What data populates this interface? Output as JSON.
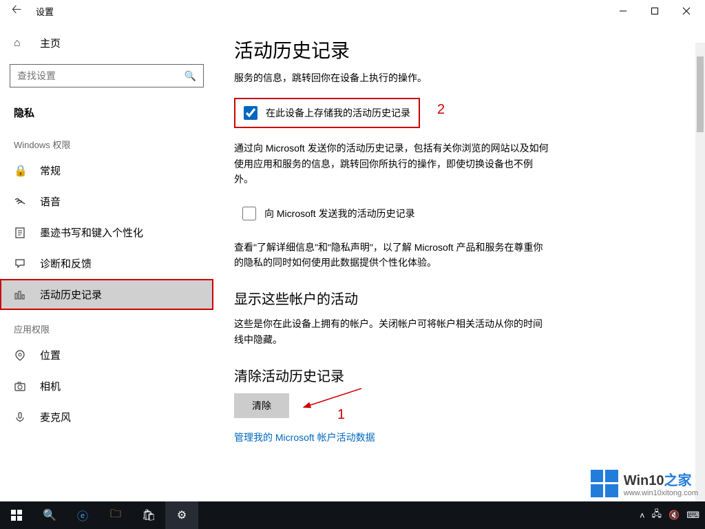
{
  "window": {
    "title": "设置"
  },
  "sidebar": {
    "home": "主页",
    "search_placeholder": "查找设置",
    "section": "隐私",
    "groups": [
      {
        "title": "Windows 权限",
        "items": [
          {
            "icon": "lock-icon",
            "label": "常规"
          },
          {
            "icon": "speech-icon",
            "label": "语音"
          },
          {
            "icon": "ink-icon",
            "label": "墨迹书写和键入个性化"
          },
          {
            "icon": "feedback-icon",
            "label": "诊断和反馈"
          },
          {
            "icon": "history-icon",
            "label": "活动历史记录",
            "selected": true,
            "highlight": true
          }
        ]
      },
      {
        "title": "应用权限",
        "items": [
          {
            "icon": "location-icon",
            "label": "位置"
          },
          {
            "icon": "camera-icon",
            "label": "相机"
          },
          {
            "icon": "mic-icon",
            "label": "麦克风"
          }
        ]
      }
    ]
  },
  "main": {
    "heading": "活动历史记录",
    "desc1": "服务的信息，跳转回你在设备上执行的操作。",
    "checkbox1": {
      "label": "在此设备上存储我的活动历史记录",
      "checked": true
    },
    "desc2": "通过向 Microsoft 发送你的活动历史记录，包括有关你浏览的网站以及如何使用应用和服务的信息，跳转回你所执行的操作，即使切换设备也不例外。",
    "checkbox2": {
      "label": "向 Microsoft 发送我的活动历史记录",
      "checked": false
    },
    "desc3": "查看\"了解详细信息\"和\"隐私声明\"，以了解 Microsoft 产品和服务在尊重你的隐私的同时如何使用此数据提供个性化体验。",
    "section2_heading": "显示这些帐户的活动",
    "section2_desc": "这些是你在此设备上拥有的帐户。关闭帐户可将帐户相关活动从你的时间线中隐藏。",
    "section3_heading": "清除活动历史记录",
    "clear_button": "清除",
    "manage_link": "管理我的 Microsoft 帐户活动数据"
  },
  "annotations": {
    "a1": "1",
    "a2": "2"
  },
  "watermark": {
    "brand_a": "Win10",
    "brand_b": "之家",
    "url": "www.win10xitong.com"
  },
  "taskbar": {
    "time": "",
    "tray_icons": [
      "chevron-up-icon",
      "network-icon",
      "volume-mute-icon",
      "ime-icon"
    ]
  }
}
